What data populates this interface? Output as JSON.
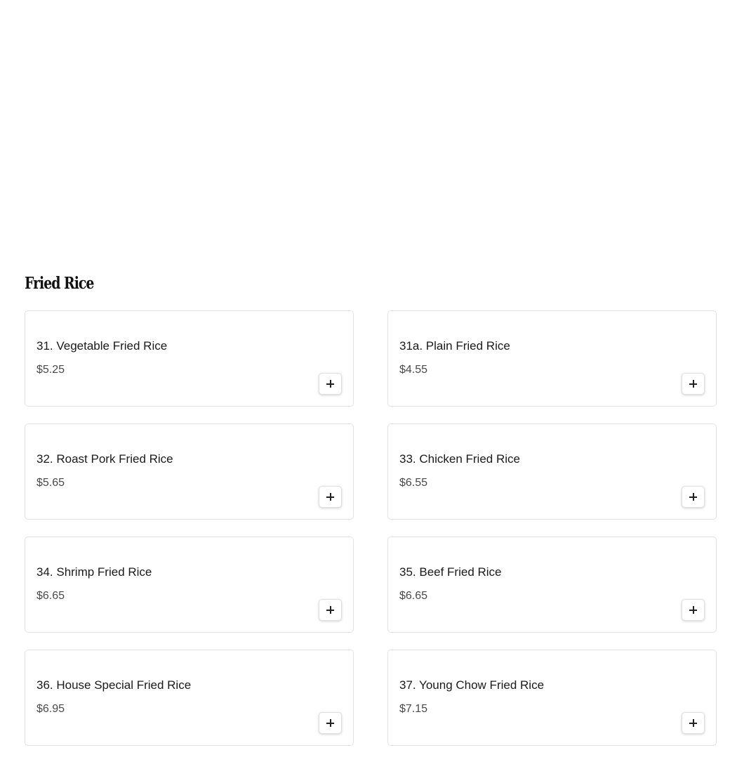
{
  "section": {
    "title": "Fried Rice",
    "items": [
      {
        "name": "31. Vegetable Fried Rice",
        "price": "$5.25"
      },
      {
        "name": "31a. Plain Fried Rice",
        "price": "$4.55"
      },
      {
        "name": "32. Roast Pork Fried Rice",
        "price": "$5.65"
      },
      {
        "name": "33. Chicken Fried Rice",
        "price": "$6.55"
      },
      {
        "name": "34. Shrimp Fried Rice",
        "price": "$6.65"
      },
      {
        "name": "35. Beef Fried Rice",
        "price": "$6.65"
      },
      {
        "name": "36. House Special Fried Rice",
        "price": "$6.95"
      },
      {
        "name": "37. Young Chow Fried Rice",
        "price": "$7.15"
      }
    ]
  },
  "icons": {
    "add": "plus-icon"
  }
}
